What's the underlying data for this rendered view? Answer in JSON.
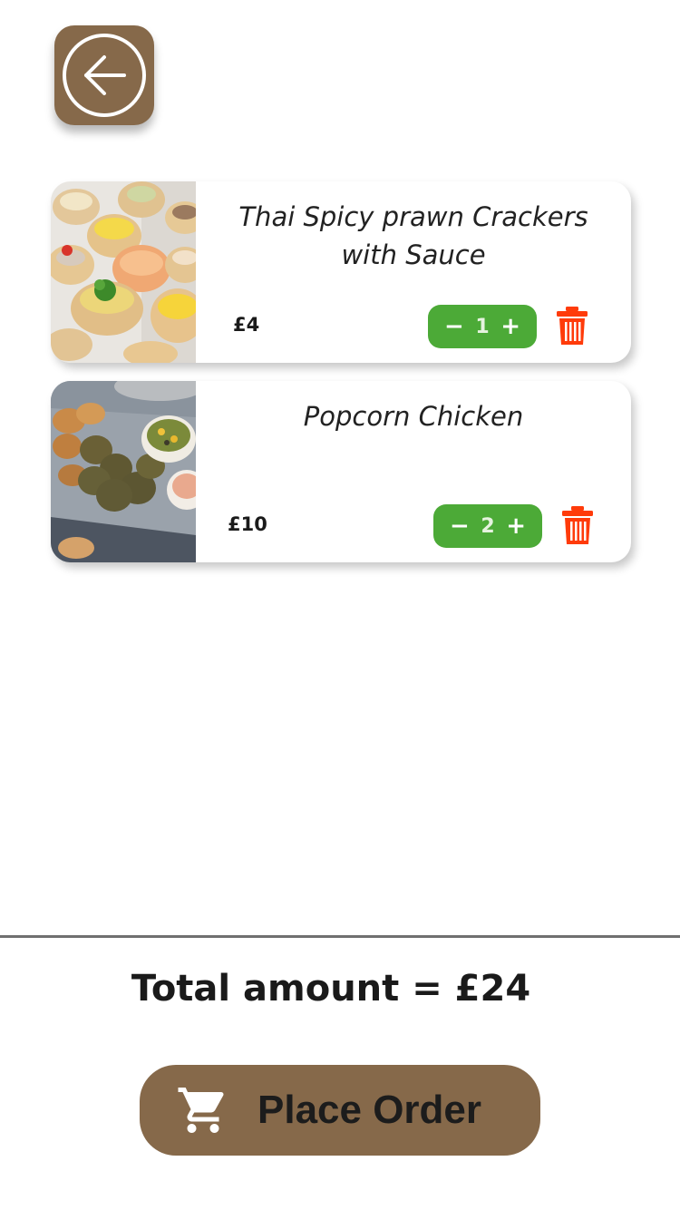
{
  "header": {
    "back_icon": "arrow-left-circle-icon"
  },
  "cart": {
    "items": [
      {
        "name_line1": "Thai Spicy prawn Crackers",
        "name_line2": "with Sauce",
        "price": "£4",
        "quantity": "1",
        "minus": "−",
        "plus": "+",
        "image_icon": "vol-au-vent-photo",
        "delete_icon": "trash-icon"
      },
      {
        "name_line1": "Popcorn Chicken",
        "name_line2": "",
        "price": "£10",
        "quantity": "2",
        "minus": "−",
        "plus": "+",
        "image_icon": "popcorn-chicken-photo",
        "delete_icon": "trash-icon"
      }
    ]
  },
  "summary": {
    "total_label": "Total amount",
    "equals": " = ",
    "total_value": "£24"
  },
  "actions": {
    "place_order_label": "Place Order",
    "cart_icon": "shopping-cart-icon"
  },
  "colors": {
    "brand_brown": "#86694a",
    "stepper_green": "#4caa37",
    "delete_red": "#ff3b0a",
    "divider_gray": "#707070"
  }
}
